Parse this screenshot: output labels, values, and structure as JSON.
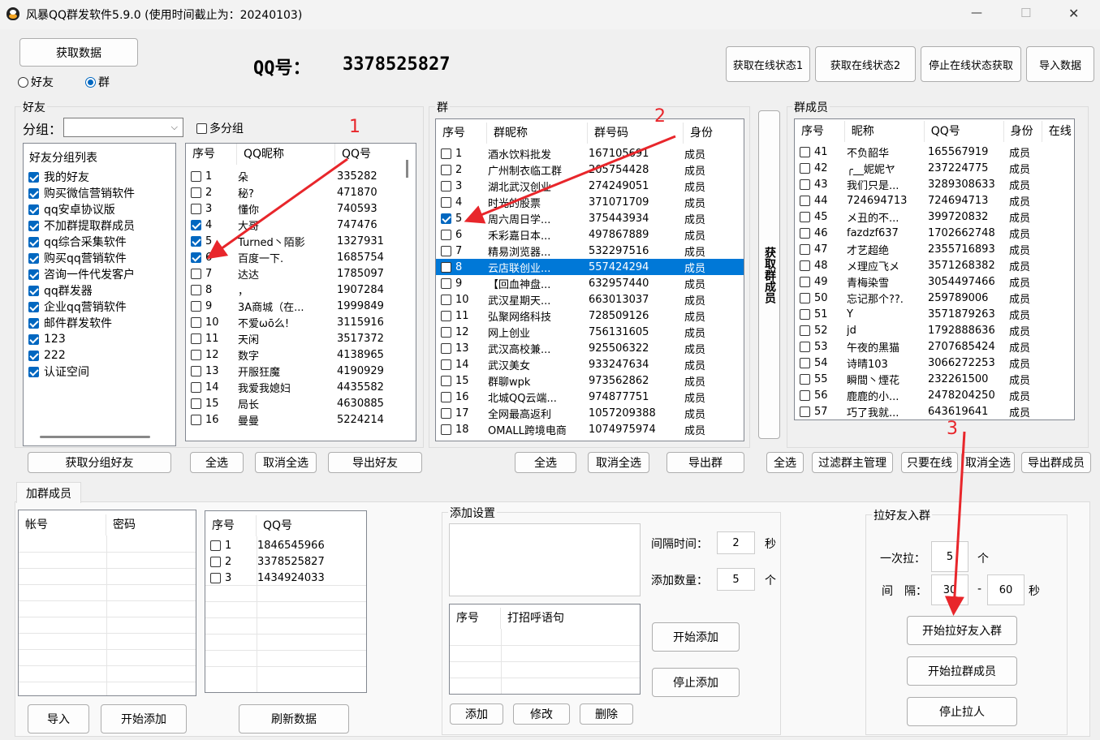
{
  "window": {
    "title": "风暴QQ群发软件5.9.0  (使用时间截止为：20240103)",
    "minimize": "—",
    "maximize": "☐",
    "close": "✕"
  },
  "top": {
    "fetch_button": "获取数据",
    "radio_friend": "好友",
    "radio_group": "群",
    "qq_label": "QQ号：",
    "qq_value": "3378525827",
    "buttons": [
      "获取在线状态1",
      "获取在线状态2",
      "停止在线状态获取",
      "导入数据"
    ]
  },
  "friends": {
    "caption": "好友",
    "group_label": "分组：",
    "multi_group": "多分组",
    "tree_title": "好友分组列表",
    "tree": [
      "我的好友",
      "购买微信营销软件",
      "qq安卓协议版",
      "不加群提取群成员",
      "qq综合采集软件",
      "购买qq营销软件",
      "咨询一件代发客户",
      "qq群发器",
      "企业qq营销软件",
      "邮件群发软件",
      "123",
      "222",
      "认证空间"
    ],
    "headers": [
      "序号",
      "QQ昵称",
      "QQ号"
    ],
    "rows": [
      {
        "no": "1",
        "nick": "朵",
        "qq": "335282",
        "checked": false
      },
      {
        "no": "2",
        "nick": "秘?",
        "qq": "471870",
        "checked": false
      },
      {
        "no": "3",
        "nick": "懂你",
        "qq": "740593",
        "checked": false
      },
      {
        "no": "4",
        "nick": "大哥",
        "qq": "747476",
        "checked": true
      },
      {
        "no": "5",
        "nick": "Turned丶陌影",
        "qq": "1327931",
        "checked": true
      },
      {
        "no": "6",
        "nick": "百度一下.",
        "qq": "1685754",
        "checked": true
      },
      {
        "no": "7",
        "nick": "达达",
        "qq": "1785097",
        "checked": false
      },
      {
        "no": "8",
        "nick": "，",
        "qq": "1907284",
        "checked": false
      },
      {
        "no": "9",
        "nick": "3A商城（在...",
        "qq": "1999849",
        "checked": false
      },
      {
        "no": "10",
        "nick": "不爱ωō么!",
        "qq": "3115916",
        "checked": false
      },
      {
        "no": "11",
        "nick": "天闲",
        "qq": "3517372",
        "checked": false
      },
      {
        "no": "12",
        "nick": "数字",
        "qq": "4138965",
        "checked": false
      },
      {
        "no": "13",
        "nick": "开服狂魔",
        "qq": "4190929",
        "checked": false
      },
      {
        "no": "14",
        "nick": "我爱我媳妇",
        "qq": "4435582",
        "checked": false
      },
      {
        "no": "15",
        "nick": "局长",
        "qq": "4630885",
        "checked": false
      },
      {
        "no": "16",
        "nick": "曼曼",
        "qq": "5224214",
        "checked": false
      }
    ],
    "btn_fetch": "获取分组好友",
    "btn_all": "全选",
    "btn_none": "取消全选",
    "btn_export": "导出好友"
  },
  "groups": {
    "caption": "群",
    "headers": [
      "序号",
      "群昵称",
      "群号码",
      "身份"
    ],
    "rows": [
      {
        "no": "1",
        "name": "酒水饮料批发",
        "num": "167105691",
        "role": "成员"
      },
      {
        "no": "2",
        "name": "广州制衣临工群",
        "num": "205754428",
        "role": "成员"
      },
      {
        "no": "3",
        "name": "湖北武汉创业",
        "num": "274249051",
        "role": "成员"
      },
      {
        "no": "4",
        "name": "时光的股票",
        "num": "371071709",
        "role": "成员"
      },
      {
        "no": "5",
        "name": "周六周日学...",
        "num": "375443934",
        "role": "成员"
      },
      {
        "no": "6",
        "name": "禾彩嘉日本...",
        "num": "497867889",
        "role": "成员"
      },
      {
        "no": "7",
        "name": "精易浏览器...",
        "num": "532297516",
        "role": "成员"
      },
      {
        "no": "8",
        "name": "云店联创业...",
        "num": "557424294",
        "role": "成员"
      },
      {
        "no": "9",
        "name": "【回血神盘...",
        "num": "632957440",
        "role": "成员"
      },
      {
        "no": "10",
        "name": "武汉星期天...",
        "num": "663013037",
        "role": "成员"
      },
      {
        "no": "11",
        "name": "弘聚网络科技",
        "num": "728509126",
        "role": "成员"
      },
      {
        "no": "12",
        "name": "网上创业",
        "num": "756131605",
        "role": "成员"
      },
      {
        "no": "13",
        "name": "武汉高校兼...",
        "num": "925506322",
        "role": "成员"
      },
      {
        "no": "14",
        "name": "武汉美女",
        "num": "933247634",
        "role": "成员"
      },
      {
        "no": "15",
        "name": "群聊wpk",
        "num": "973562862",
        "role": "成员"
      },
      {
        "no": "16",
        "name": "北城QQ云端...",
        "num": "974877751",
        "role": "成员"
      },
      {
        "no": "17",
        "name": "全网最高返利",
        "num": "1057209388",
        "role": "成员"
      },
      {
        "no": "18",
        "name": "OMALL跨境电商",
        "num": "1074975974",
        "role": "成员"
      }
    ],
    "checked_index": 4,
    "selected_index": 7,
    "side_button": "获取群成员",
    "btn_all": "全选",
    "btn_none": "取消全选",
    "btn_export": "导出群"
  },
  "members": {
    "caption": "群成员",
    "headers": [
      "序号",
      "昵称",
      "QQ号",
      "身份",
      "在线"
    ],
    "rows": [
      {
        "no": "41",
        "nick": "不负韶华",
        "qq": "165567919",
        "role": "成员"
      },
      {
        "no": "42",
        "nick": "╭__妮妮ヤ",
        "qq": "237224775",
        "role": "成员"
      },
      {
        "no": "43",
        "nick": "我们只是...",
        "qq": "3289308633",
        "role": "成员"
      },
      {
        "no": "44",
        "nick": "724694713",
        "qq": "724694713",
        "role": "成员"
      },
      {
        "no": "45",
        "nick": "メ丑的不...",
        "qq": "399720832",
        "role": "成员"
      },
      {
        "no": "46",
        "nick": "fazdzf637",
        "qq": "1702662748",
        "role": "成员"
      },
      {
        "no": "47",
        "nick": "才艺超绝",
        "qq": "2355716893",
        "role": "成员"
      },
      {
        "no": "48",
        "nick": "メ理应飞メ",
        "qq": "3571268382",
        "role": "成员"
      },
      {
        "no": "49",
        "nick": "青梅染雪",
        "qq": "3054497466",
        "role": "成员"
      },
      {
        "no": "50",
        "nick": "忘记那个??.",
        "qq": "259789006",
        "role": "成员"
      },
      {
        "no": "51",
        "nick": "Y",
        "qq": "3571879263",
        "role": "成员"
      },
      {
        "no": "52",
        "nick": "jd",
        "qq": "1792888636",
        "role": "成员"
      },
      {
        "no": "53",
        "nick": "午夜的黑猫",
        "qq": "2707685424",
        "role": "成员"
      },
      {
        "no": "54",
        "nick": "诗晴103",
        "qq": "3066272253",
        "role": "成员"
      },
      {
        "no": "55",
        "nick": "瞬間丶煙花",
        "qq": "232261500",
        "role": "成员"
      },
      {
        "no": "56",
        "nick": "鹿鹿的小...",
        "qq": "2478204250",
        "role": "成员"
      },
      {
        "no": "57",
        "nick": "巧了我就...",
        "qq": "643619641",
        "role": "成员"
      }
    ],
    "btn_all": "全选",
    "btn_filter": "过滤群主管理",
    "btn_online": "只要在线",
    "btn_none": "取消全选",
    "btn_export": "导出群成员"
  },
  "bottom": {
    "tab": "加群成员",
    "acct_headers": [
      "帐号",
      "密码"
    ],
    "qq_headers": [
      "序号",
      "QQ号"
    ],
    "qq_rows": [
      {
        "no": "1",
        "qq": "1846545966"
      },
      {
        "no": "2",
        "qq": "3378525827"
      },
      {
        "no": "3",
        "qq": "1434924033"
      }
    ],
    "btn_import": "导入",
    "btn_start_add": "开始添加",
    "btn_refresh": "刷新数据",
    "add_settings": "添加设置",
    "interval_label": "间隔时间：",
    "interval_value": "2",
    "interval_unit": "秒",
    "count_label": "添加数量：",
    "count_value": "5",
    "count_unit": "个",
    "greet_headers": [
      "序号",
      "打招呼语句"
    ],
    "btn_start": "开始添加",
    "btn_stop": "停止添加",
    "btn_add": "添加",
    "btn_edit": "修改",
    "btn_delete": "删除",
    "pull": {
      "caption": "拉好友入群",
      "once_label": "一次拉：",
      "once_value": "5",
      "once_unit": "个",
      "gap_label": "间　隔：",
      "gap_from": "30",
      "gap_dash": "-",
      "gap_to": "60",
      "gap_unit": "秒",
      "btn_pull_friends": "开始拉好友入群",
      "btn_pull_members": "开始拉群成员",
      "btn_stop": "停止拉人"
    }
  },
  "annotations": [
    "1",
    "2",
    "3"
  ],
  "colors": {
    "arrow": "#e8262b",
    "selection": "#0078d7",
    "check": "#0067c0"
  }
}
